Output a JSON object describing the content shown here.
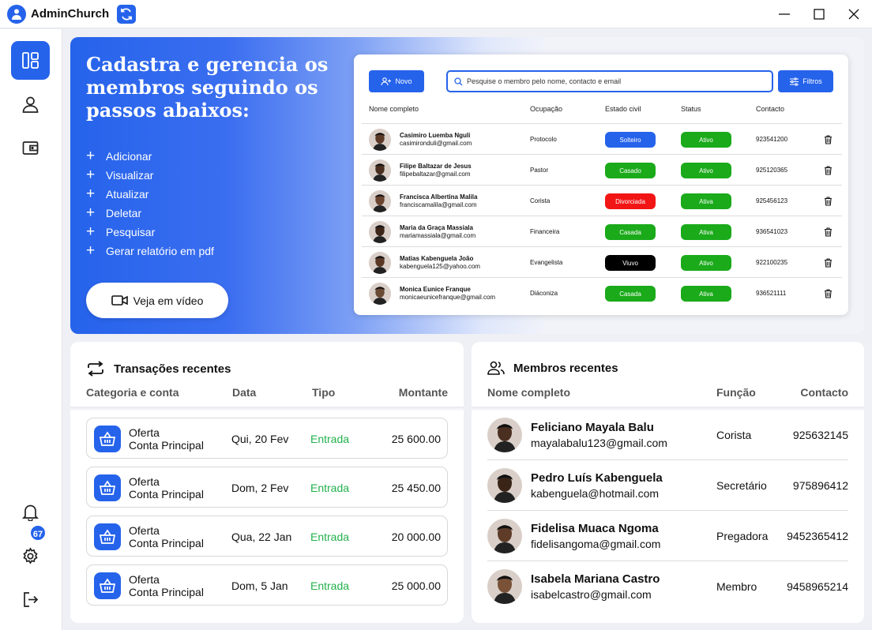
{
  "app": {
    "title": "AdminChurch"
  },
  "notifications": {
    "count": "67"
  },
  "hero": {
    "title": "Cadastra e gerencia os membros seguindo os passos abaixos:",
    "steps": [
      "Adicionar",
      "Visualizar",
      "Atualizar",
      "Deletar",
      "Pesquisar",
      "Gerar relatório em pdf"
    ],
    "video_button": "Veja em vídeo"
  },
  "preview": {
    "new_button": "Novo",
    "search_placeholder": "Pesquise o membro pelo nome, contacto e email",
    "filter_button": "Filtros",
    "columns": [
      "Nome completo",
      "Ocupação",
      "Estado civil",
      "Status",
      "Contacto"
    ],
    "rows": [
      {
        "name": "Casimiro Luemba Nguli",
        "email": "casimironduli@gmail.com",
        "occupation": "Protocolo",
        "civil": "Solteiro",
        "civil_color": "#2563eb",
        "status": "Ativo",
        "contact": "923541200"
      },
      {
        "name": "Filipe Baltazar de Jesus",
        "email": "filipebaltazar@gmail.com",
        "occupation": "Pastor",
        "civil": "Casado",
        "civil_color": "#1aaa1a",
        "status": "Ativo",
        "contact": "925120365"
      },
      {
        "name": "Francisca Albertina Malila",
        "email": "franciscamalila@gmail.com",
        "occupation": "Corista",
        "civil": "Divorciada",
        "civil_color": "#f21515",
        "status": "Ativa",
        "contact": "925456123"
      },
      {
        "name": "Maria da Graça Massiala",
        "email": "mariamassiala@gmail.com",
        "occupation": "Financeira",
        "civil": "Casada",
        "civil_color": "#1aaa1a",
        "status": "Ativa",
        "contact": "936541023"
      },
      {
        "name": "Matias Kabenguela João",
        "email": "kabenguela125@yahoo.com",
        "occupation": "Evangelista",
        "civil": "Viuvo",
        "civil_color": "#000000",
        "status": "Ativo",
        "contact": "922100235"
      },
      {
        "name": "Monica Eunice Franque",
        "email": "monicaeunicefranque@gmail.com",
        "occupation": "Diáconiza",
        "civil": "Casada",
        "civil_color": "#1aaa1a",
        "status": "Ativa",
        "contact": "936521111"
      }
    ]
  },
  "transactions": {
    "title": "Transações recentes",
    "columns": [
      "Categoria e conta",
      "Data",
      "Tipo",
      "Montante"
    ],
    "rows": [
      {
        "category": "Oferta",
        "account": "Conta Principal",
        "date": "Qui, 20 Fev",
        "type": "Entrada",
        "amount": "25 600.00"
      },
      {
        "category": "Oferta",
        "account": "Conta Principal",
        "date": "Dom, 2 Fev",
        "type": "Entrada",
        "amount": "25 450.00"
      },
      {
        "category": "Oferta",
        "account": "Conta Principal",
        "date": "Qua, 22 Jan",
        "type": "Entrada",
        "amount": "20 000.00"
      },
      {
        "category": "Oferta",
        "account": "Conta Principal",
        "date": "Dom, 5 Jan",
        "type": "Entrada",
        "amount": "25 000.00"
      }
    ]
  },
  "members": {
    "title": "Membros recentes",
    "columns": [
      "Nome completo",
      "Função",
      "Contacto"
    ],
    "rows": [
      {
        "name": "Feliciano Mayala Balu",
        "email": "mayalabalu123@gmail.com",
        "role": "Corista",
        "contact": "925632145"
      },
      {
        "name": "Pedro Luís Kabenguela",
        "email": "kabenguela@hotmail.com",
        "role": "Secretário",
        "contact": "975896412"
      },
      {
        "name": "Fidelisa Muaca Ngoma",
        "email": "fidelisangoma@gmail.com",
        "role": "Pregadora",
        "contact": "9452365412"
      },
      {
        "name": "Isabela Mariana Castro",
        "email": "isabelcastro@gmail.com",
        "role": "Membro",
        "contact": "9458965214"
      }
    ]
  },
  "colors": {
    "accent": "#2563eb",
    "success": "#1aaa1a",
    "income": "#22b14c"
  }
}
